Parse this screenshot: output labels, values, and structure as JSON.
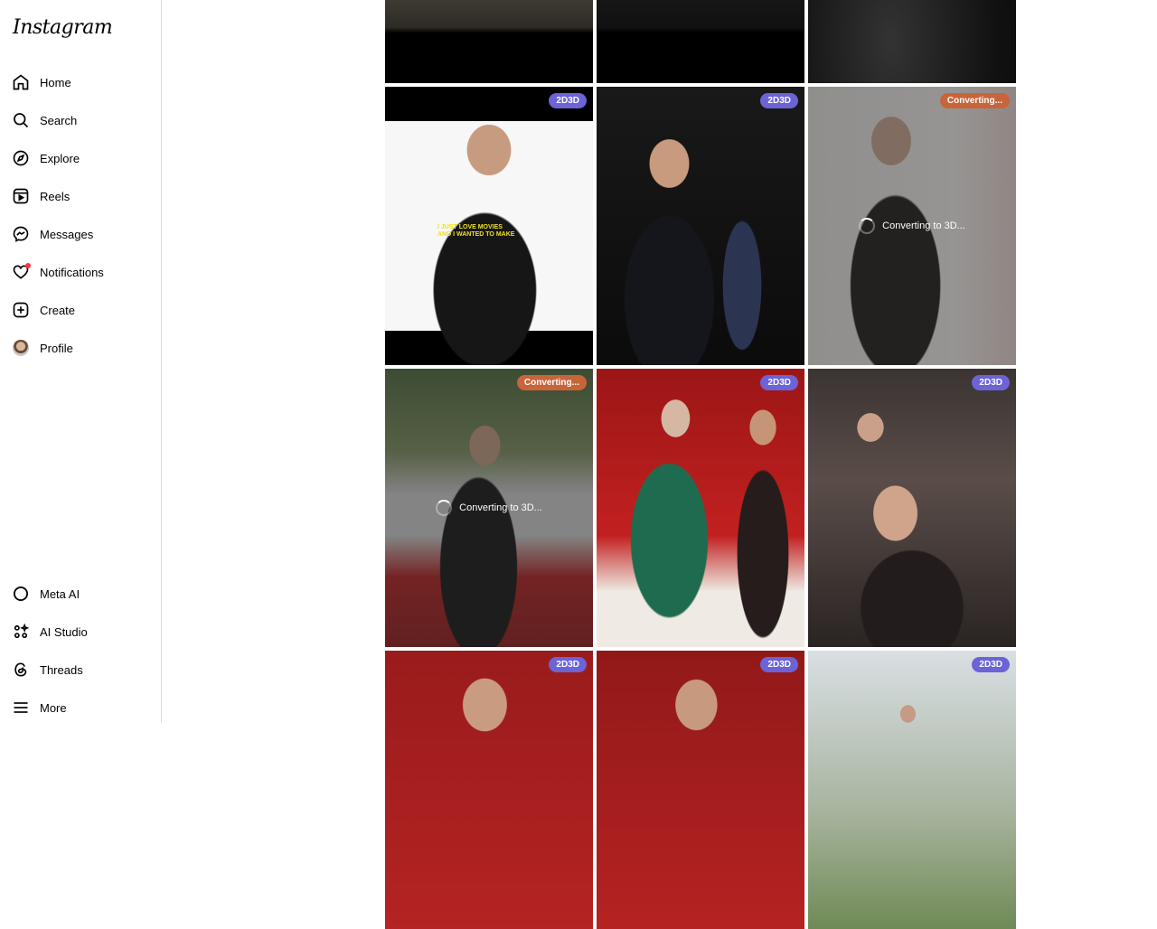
{
  "app": {
    "logo_text": "Instagram"
  },
  "sidebar": {
    "items": [
      {
        "label": "Home",
        "icon": "home-icon"
      },
      {
        "label": "Search",
        "icon": "search-icon"
      },
      {
        "label": "Explore",
        "icon": "compass-icon"
      },
      {
        "label": "Reels",
        "icon": "reels-icon"
      },
      {
        "label": "Messages",
        "icon": "messenger-icon"
      },
      {
        "label": "Notifications",
        "icon": "heart-icon"
      },
      {
        "label": "Create",
        "icon": "plus-square-icon"
      },
      {
        "label": "Profile",
        "icon": "avatar"
      }
    ],
    "bottom_items": [
      {
        "label": "Meta AI",
        "icon": "meta-ai-icon"
      },
      {
        "label": "AI Studio",
        "icon": "ai-studio-icon"
      },
      {
        "label": "Threads",
        "icon": "threads-icon"
      },
      {
        "label": "More",
        "icon": "menu-icon"
      }
    ]
  },
  "grid": {
    "badge_2d3d": "2D3D",
    "badge_converting": "Converting...",
    "overlay_text": "Converting to 3D...",
    "caption_line1": "I JUST LOVE MOVIES",
    "caption_line2": "AND I WANTED TO MAKE",
    "tiles": [
      {
        "row": 0,
        "col": 0,
        "badge": "",
        "converting": false
      },
      {
        "row": 0,
        "col": 1,
        "badge": "",
        "converting": false
      },
      {
        "row": 0,
        "col": 2,
        "badge": "",
        "converting": false
      },
      {
        "row": 1,
        "col": 0,
        "badge": "2D3D",
        "converting": false
      },
      {
        "row": 1,
        "col": 1,
        "badge": "2D3D",
        "converting": false
      },
      {
        "row": 1,
        "col": 2,
        "badge": "Converting...",
        "converting": true
      },
      {
        "row": 2,
        "col": 0,
        "badge": "Converting...",
        "converting": true
      },
      {
        "row": 2,
        "col": 1,
        "badge": "2D3D",
        "converting": false
      },
      {
        "row": 2,
        "col": 2,
        "badge": "2D3D",
        "converting": false
      },
      {
        "row": 3,
        "col": 0,
        "badge": "2D3D",
        "converting": false
      },
      {
        "row": 3,
        "col": 1,
        "badge": "2D3D",
        "converting": false
      },
      {
        "row": 3,
        "col": 2,
        "badge": "2D3D",
        "converting": false
      }
    ]
  },
  "colors": {
    "badge": "#6c63d6",
    "badge_converting": "#c8643a",
    "notification": "#ff3040"
  }
}
